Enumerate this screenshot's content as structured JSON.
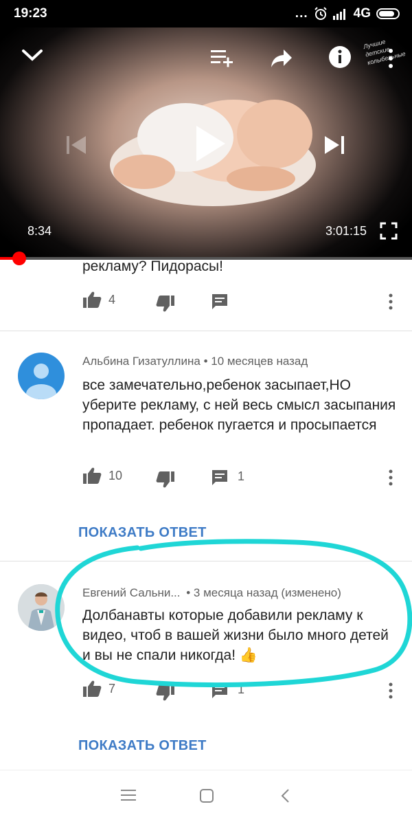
{
  "status": {
    "time": "19:23",
    "dots": "...",
    "network": "4G"
  },
  "player": {
    "current_time": "8:34",
    "total_time": "3:01:15",
    "progress": 0.047,
    "watermark": "Лучшие детские колыбельные"
  },
  "comments": [
    {
      "text": "рекламу? Пидорасы!",
      "likes": "4",
      "replies": ""
    },
    {
      "author": "Альбина Гизатуллина",
      "age": "• 10 месяцев назад",
      "text": "все замечательно,ребенок засыпает,НО уберите рекламу, с ней весь смысл засыпания пропадает. ребенок пугается и просыпается",
      "likes": "10",
      "replies": "1",
      "show_reply": "ПОКАЗАТЬ ОТВЕТ"
    },
    {
      "author": "Евгений Сальни...",
      "age": "• 3 месяца назад (изменено)",
      "text": "Долбанавты которые добавили рекламу к видео, чтоб в вашей жизни было много детей и вы не спали никогда!",
      "emoji": "👍",
      "likes": "7",
      "replies": "1",
      "show_reply": "ПОКАЗАТЬ ОТВЕТ"
    }
  ],
  "colors": {
    "accent_link": "#3e7bc6",
    "highlight": "#1fd6d6",
    "progress": "#ff0000"
  }
}
